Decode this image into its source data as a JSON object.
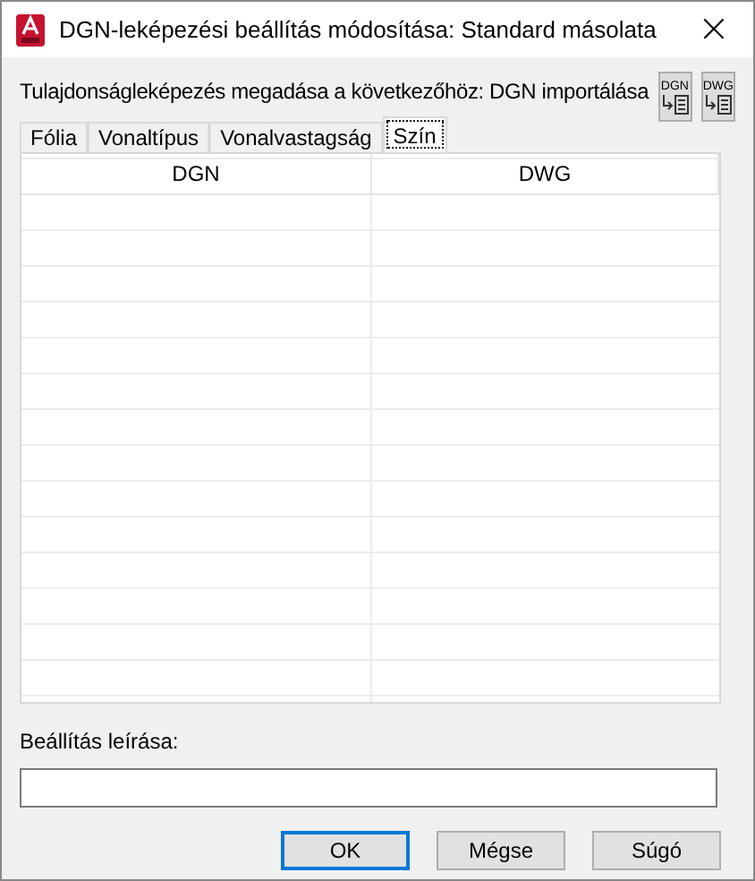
{
  "window": {
    "title": "DGN-leképezési beállítás módosítása: Standard másolata",
    "close": "×"
  },
  "description": "Tulajdonságleképezés megadása a következőhöz: DGN importálása",
  "tool_buttons": [
    {
      "label": "DGN"
    },
    {
      "label": "DWG"
    }
  ],
  "tabs": [
    {
      "label": "Fólia",
      "selected": false
    },
    {
      "label": "Vonaltípus",
      "selected": false
    },
    {
      "label": "Vonalvastagság",
      "selected": false
    },
    {
      "label": "Szín",
      "selected": true
    }
  ],
  "table": {
    "columns": [
      "DGN",
      "DWG"
    ]
  },
  "setting_description": {
    "label": "Beállítás leírása:"
  },
  "buttons": [
    {
      "label": "OK",
      "default": true
    },
    {
      "label": "Mégse",
      "default": false
    },
    {
      "label": "Súgó",
      "default": false
    }
  ]
}
